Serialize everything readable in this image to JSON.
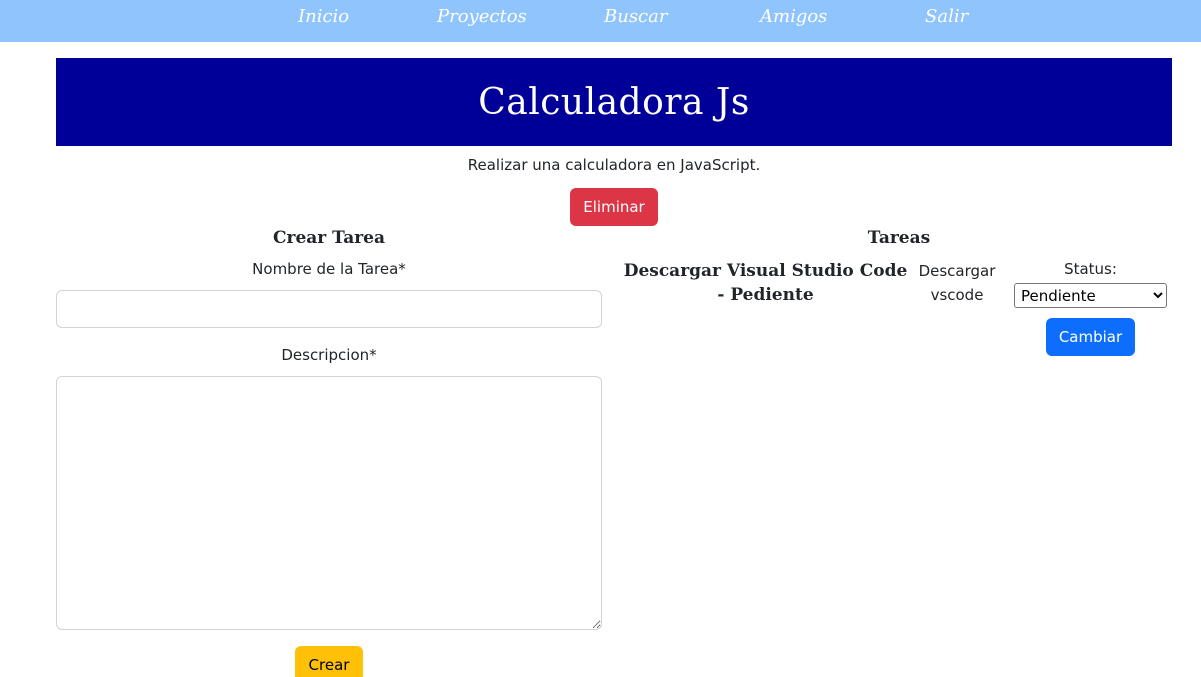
{
  "nav": {
    "items": [
      "Inicio",
      "Proyectos",
      "Buscar",
      "Amigos",
      "Salir"
    ]
  },
  "header": {
    "title": "Calculadora Js"
  },
  "project": {
    "description": "Realizar una calculadora en JavaScript.",
    "delete_label": "Eliminar"
  },
  "form": {
    "title": "Crear Tarea",
    "name_label": "Nombre de la Tarea*",
    "name_value": "",
    "description_label": "Descripcion*",
    "description_value": "",
    "submit_label": "Crear"
  },
  "tasks": {
    "title": "Tareas",
    "items": [
      {
        "title": "Descargar Visual Studio Code - Pediente",
        "description": "Descargar vscode",
        "status_label": "Status:",
        "status_selected": "Pendiente",
        "change_label": "Cambiar"
      }
    ]
  },
  "colors": {
    "navbar": "#90c4fc",
    "hero": "#000099",
    "danger": "#dc3545",
    "primary": "#0d6efd",
    "warning": "#ffc107"
  }
}
